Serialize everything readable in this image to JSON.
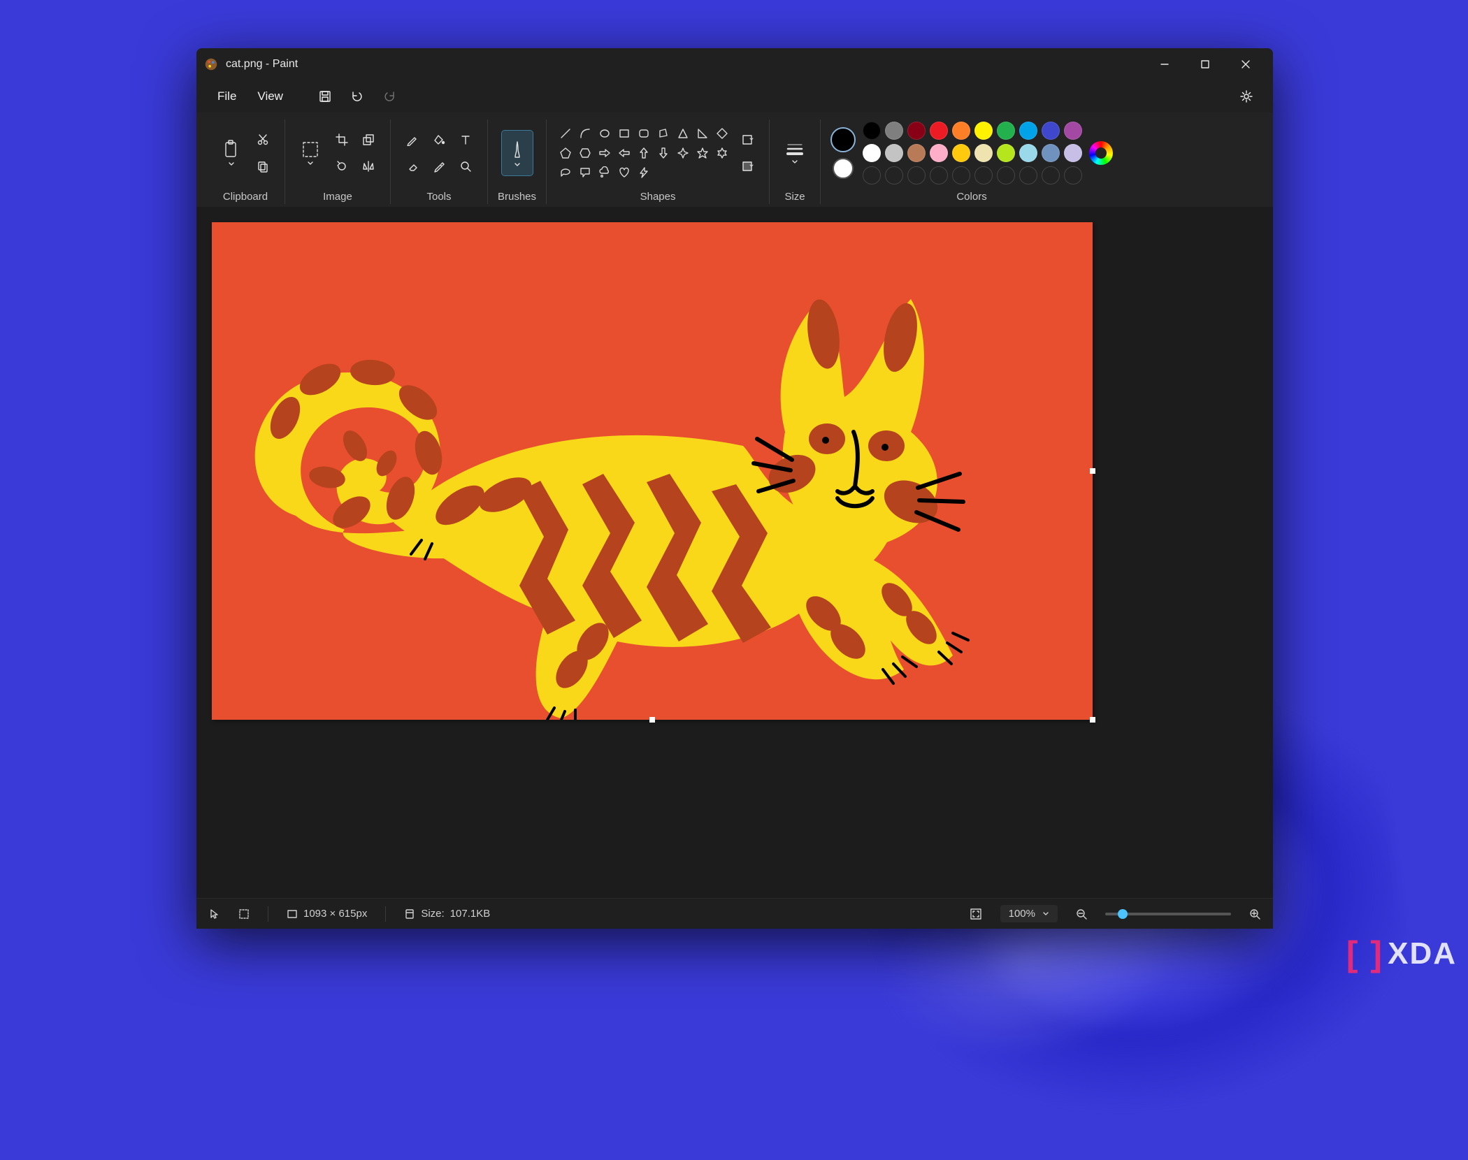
{
  "window": {
    "title": "cat.png - Paint",
    "app_name": "Paint",
    "file_name": "cat.png"
  },
  "menu": {
    "file": "File",
    "view": "View"
  },
  "ribbon": {
    "clipboard": {
      "label": "Clipboard"
    },
    "image": {
      "label": "Image"
    },
    "tools": {
      "label": "Tools"
    },
    "brushes": {
      "label": "Brushes"
    },
    "shapes": {
      "label": "Shapes"
    },
    "size": {
      "label": "Size"
    },
    "colors": {
      "label": "Colors"
    }
  },
  "colors": {
    "primary": "#000000",
    "secondary": "#ffffff",
    "palette_row1": [
      "#000000",
      "#7f7f7f",
      "#880015",
      "#ed1c24",
      "#ff7f27",
      "#fff200",
      "#22b14c",
      "#00a2e8",
      "#3f48cc",
      "#a349a4"
    ],
    "palette_row2": [
      "#ffffff",
      "#c3c3c3",
      "#b97a57",
      "#ffaec9",
      "#ffc90e",
      "#efe4b0",
      "#b5e61d",
      "#99d9ea",
      "#7092be",
      "#c8bfe7"
    ]
  },
  "canvas": {
    "background": "#e84f2e",
    "cat_body_color": "#f9d81a",
    "cat_stripe_color": "#b5431e"
  },
  "status": {
    "dimensions": "1093 × 615px",
    "size_label": "Size:",
    "size_value": "107.1KB",
    "zoom": "100%"
  },
  "watermark": {
    "text": "XDA"
  }
}
